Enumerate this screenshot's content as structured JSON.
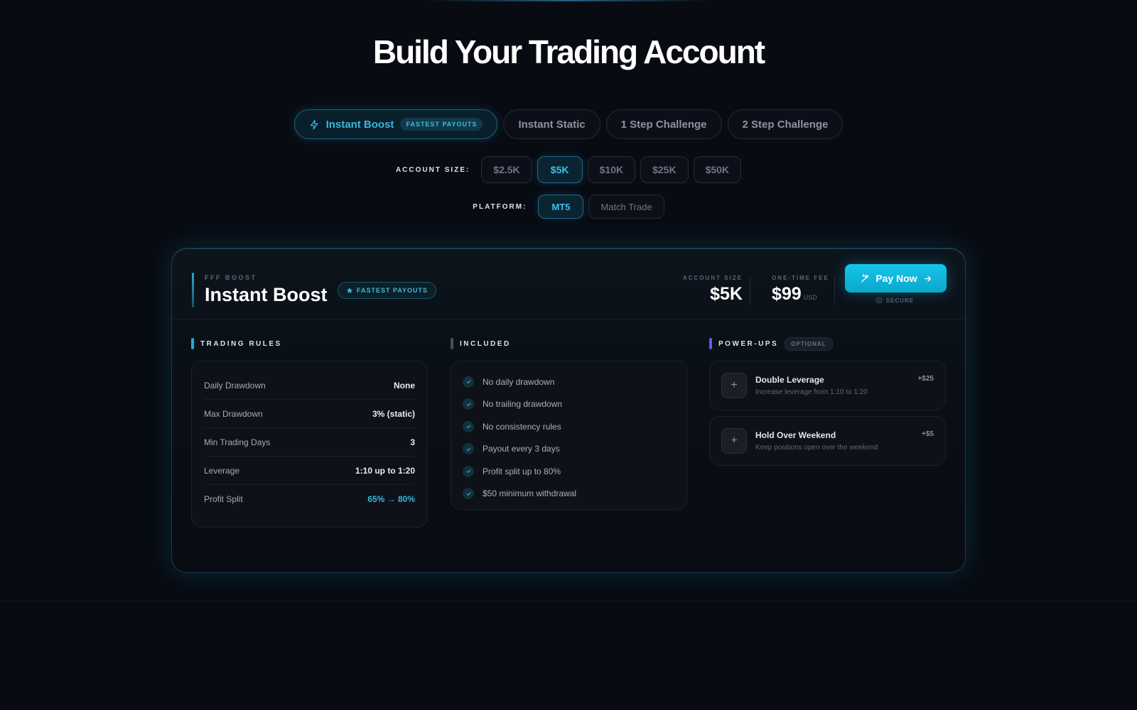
{
  "page": {
    "title": "Build Your Trading Account"
  },
  "tabs": [
    {
      "label": "Instant Boost",
      "badge": "FASTEST PAYOUTS",
      "icon": "lightning-icon",
      "active": true
    },
    {
      "label": "Instant Static"
    },
    {
      "label": "1 Step Challenge"
    },
    {
      "label": "2 Step Challenge"
    }
  ],
  "account_size": {
    "label": "ACCOUNT SIZE:",
    "options": [
      "$2.5K",
      "$5K",
      "$10K",
      "$25K",
      "$50K"
    ],
    "selected": "$5K"
  },
  "platform": {
    "label": "PLATFORM:",
    "options": [
      "MT5",
      "Match Trade"
    ],
    "selected": "MT5"
  },
  "card": {
    "eyebrow": "FFF BOOST",
    "title": "Instant Boost",
    "badge": "FASTEST PAYOUTS",
    "account_size_label": "ACCOUNT SIZE",
    "account_size_value": "$5K",
    "fee_label": "ONE-TIME FEE",
    "fee_value": "$99",
    "fee_unit": "USD",
    "pay_button": "Pay Now",
    "secure_label": "SECURE"
  },
  "trading_rules": {
    "title": "TRADING RULES",
    "rows": [
      {
        "label": "Daily Drawdown",
        "value": "None"
      },
      {
        "label": "Max Drawdown",
        "value": "3% (static)"
      },
      {
        "label": "Min Trading Days",
        "value": "3"
      },
      {
        "label": "Leverage",
        "value": "1:10 up to 1:20"
      },
      {
        "label": "Profit Split",
        "value": "65% → 80%",
        "accent": true
      }
    ]
  },
  "included": {
    "title": "INCLUDED",
    "items": [
      "No daily drawdown",
      "No trailing drawdown",
      "No consistency rules",
      "Payout every 3 days",
      "Profit split up to 80%",
      "$50 minimum withdrawal"
    ]
  },
  "power_ups": {
    "title": "POWER-UPS",
    "badge": "OPTIONAL",
    "items": [
      {
        "name": "Double Leverage",
        "description": "Increase leverage from 1:10 to 1:20",
        "price": "+$25"
      },
      {
        "name": "Hold Over Weekend",
        "description": "Keep positions open over the weekend",
        "price": "+$5"
      }
    ]
  },
  "colors": {
    "background": "#080b12",
    "accent": "#38b8dc",
    "pay_button": "#11b9de",
    "rules_bar": "#2aa9d0",
    "included_bar": "#4a4f5a",
    "powerups_bar": "#6a5ae0"
  }
}
